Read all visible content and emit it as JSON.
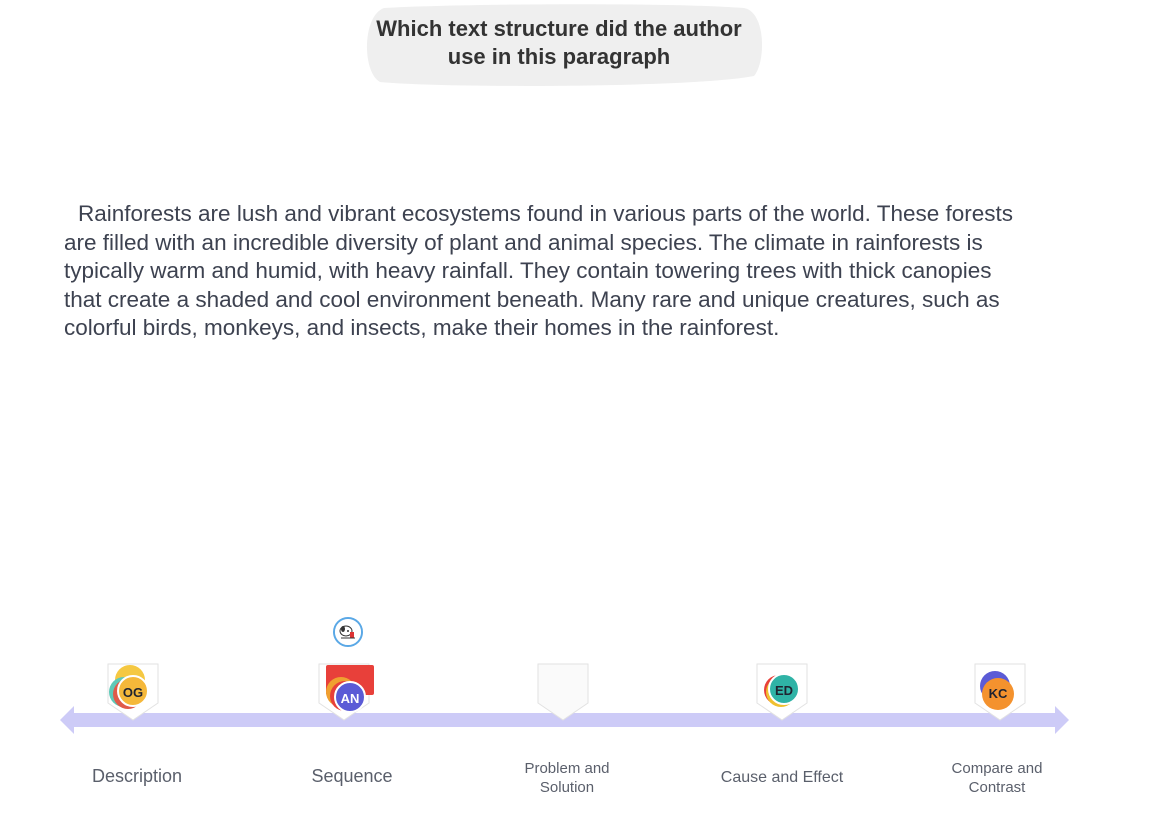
{
  "question": {
    "title": "Which text structure did the author use in this paragraph"
  },
  "passage": {
    "text": "Rainforests are lush and vibrant ecosystems found in various parts of the world. These forests are filled with an incredible diversity of plant and animal species. The climate in rainforests is typically warm and humid, with heavy rainfall. They contain towering trees with thick canopies that create a shaded and cool environment beneath. Many rare and unique creatures, such as colorful birds, monkeys, and insects, make their homes in the rainforest."
  },
  "options": [
    {
      "label": "Description",
      "avatars": [
        "OG"
      ]
    },
    {
      "label": "Sequence",
      "avatars": [
        "AN"
      ]
    },
    {
      "label": "Problem and Solution",
      "avatars": []
    },
    {
      "label": "Cause and Effect",
      "avatars": [
        "ED"
      ]
    },
    {
      "label": "Compare and Contrast",
      "avatars": [
        "KC"
      ]
    }
  ],
  "colors": {
    "track": "#cdcbf7",
    "bubble": "#efefef",
    "og": "#f5b83a",
    "an": "#5b5bd6",
    "ed": "#2fb3a6",
    "kc": "#f4922e",
    "red_card": "#e8403a"
  }
}
